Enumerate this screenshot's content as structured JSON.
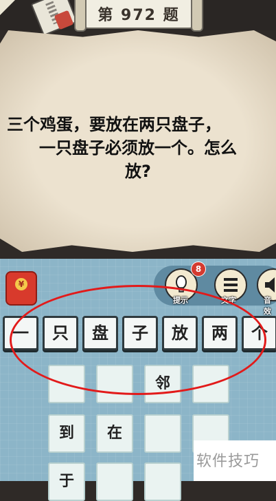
{
  "header": {
    "level_label": "第 972 题"
  },
  "question": {
    "line1": "三个鸡蛋，要放在两只盘子，",
    "line2": "一只盘子必须放一个。怎么",
    "line3": "放?"
  },
  "toolbar": {
    "hint_count": "8",
    "hint_label": "提示",
    "answer_label": "文字",
    "sound_label": "音效"
  },
  "redpack": {
    "coin_symbol": "¥"
  },
  "word_bank": [
    "一",
    "只",
    "盘",
    "子",
    "放",
    "两",
    "个"
  ],
  "answer_grid": [
    [
      "",
      "",
      "邻",
      ""
    ],
    [
      "到",
      "在",
      "",
      ""
    ],
    [
      "于",
      "",
      "",
      ""
    ]
  ],
  "watermark": "软件技巧"
}
